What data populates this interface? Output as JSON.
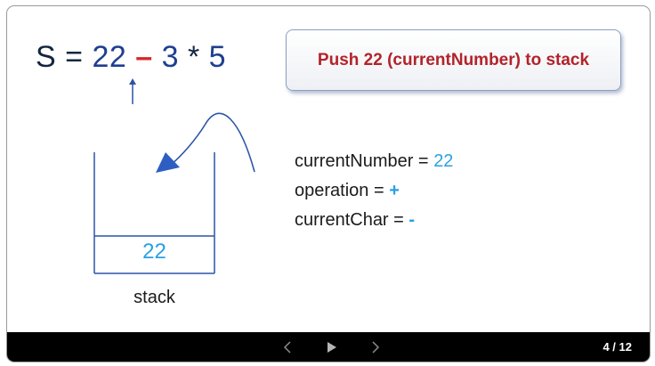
{
  "expression": {
    "lhs": "S",
    "eq": "=",
    "n1": "22",
    "op1": "–",
    "n2": "3",
    "op2": "*",
    "n3": "5"
  },
  "callout": {
    "text": "Push 22 (currentNumber) to stack"
  },
  "stack": {
    "cell_value": "22",
    "label": "stack"
  },
  "variables": [
    {
      "name": "currentNumber =",
      "value": "22"
    },
    {
      "name": "operation =",
      "value": "+"
    },
    {
      "name": "currentChar =",
      "value": "-"
    }
  ],
  "controls": {
    "counter": "4 / 12"
  },
  "colors": {
    "expression_text": "#12263f",
    "operator_highlight": "#d8262e",
    "callout_text": "#b3232b",
    "value_text": "#29a0e6",
    "diagram_stroke": "#2a55a8"
  }
}
